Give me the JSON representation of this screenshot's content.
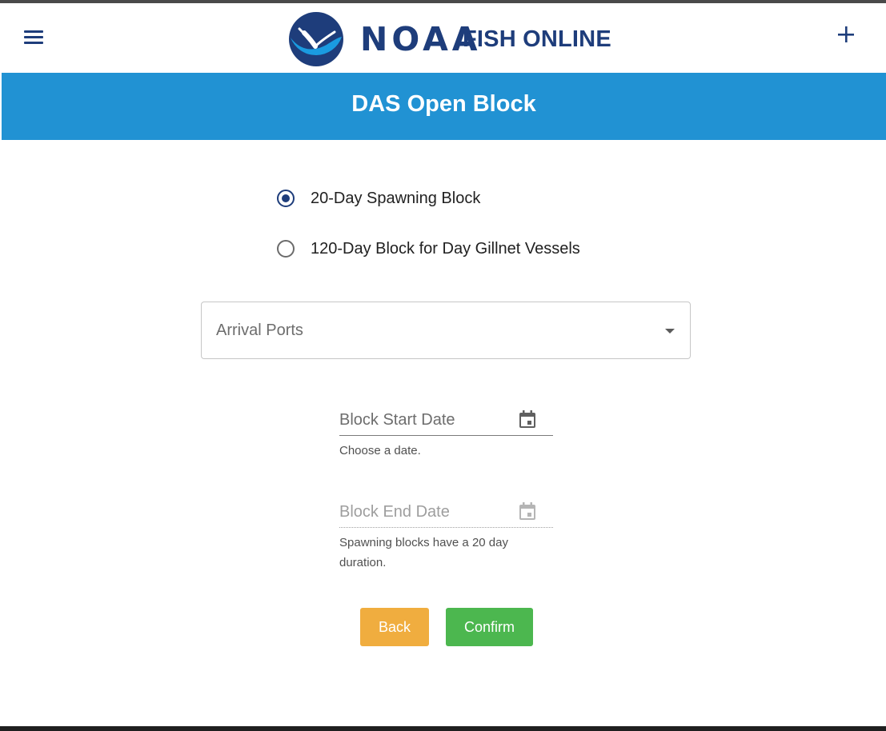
{
  "header": {
    "brand_noaa": "NOAA",
    "brand_fish": "FISH ONLINE"
  },
  "page": {
    "title": "DAS Open Block"
  },
  "options": [
    {
      "label": "20-Day Spawning Block",
      "checked": true
    },
    {
      "label": "120-Day Block for Day Gillnet Vessels",
      "checked": false
    }
  ],
  "arrival_ports": {
    "label": "Arrival Ports"
  },
  "start_date": {
    "label": "Block Start Date",
    "hint": "Choose a date."
  },
  "end_date": {
    "label": "Block End Date",
    "hint": "Spawning blocks have a 20 day duration."
  },
  "buttons": {
    "back": "Back",
    "confirm": "Confirm"
  },
  "colors": {
    "navy": "#1e3d7b",
    "title_bar": "#2192d3",
    "back_button": "#f0ad3f",
    "confirm_button": "#4cb74f",
    "logo_blue": "#1a9be0"
  },
  "icons": {
    "menu": "hamburger-menu-icon",
    "add": "plus-icon",
    "calendar": "calendar-icon",
    "dropdown": "caret-down-icon"
  }
}
